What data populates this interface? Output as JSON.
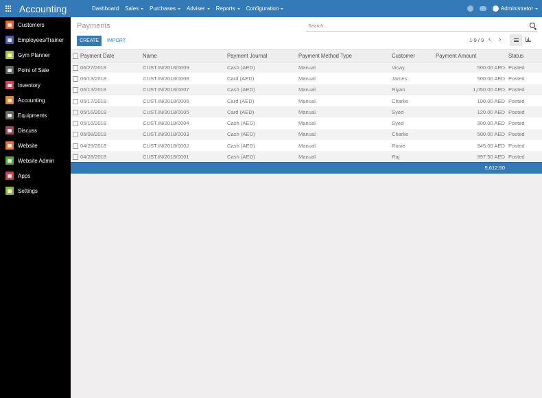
{
  "topbar": {
    "app_title": "Accounting",
    "nav": [
      {
        "label": "Dashboard",
        "dropdown": false
      },
      {
        "label": "Sales",
        "dropdown": true
      },
      {
        "label": "Purchases",
        "dropdown": true
      },
      {
        "label": "Adviser",
        "dropdown": true
      },
      {
        "label": "Reports",
        "dropdown": true
      },
      {
        "label": "Configuration",
        "dropdown": true
      }
    ],
    "user": "Administrator",
    "icons": [
      "apps-grid-icon",
      "activity-clock-icon",
      "chat-icon",
      "avatar-icon"
    ]
  },
  "sidebar": {
    "items": [
      {
        "label": "Customers",
        "icon": "customers-icon",
        "color": "#e8682a"
      },
      {
        "label": "Employees/Trainer",
        "icon": "employees-icon",
        "color": "#4b5fae"
      },
      {
        "label": "Gym Planner",
        "icon": "gym-planner-icon",
        "color": "#a9c23f"
      },
      {
        "label": "Point of Sale",
        "icon": "point-of-sale-icon",
        "color": "#596663"
      },
      {
        "label": "Inventory",
        "icon": "inventory-icon",
        "color": "#d9424e"
      },
      {
        "label": "Accounting",
        "icon": "accounting-icon",
        "color": "#e8862a"
      },
      {
        "label": "Equipments",
        "icon": "equipments-icon",
        "color": "#6b6b63"
      },
      {
        "label": "Discuss",
        "icon": "discuss-icon",
        "color": "#9b4b5e"
      },
      {
        "label": "Website",
        "icon": "website-icon",
        "color": "#e8752a"
      },
      {
        "label": "Website Admin",
        "icon": "website-admin-icon",
        "color": "#58a83f"
      },
      {
        "label": "Apps",
        "icon": "apps-icon",
        "color": "#c8424e"
      },
      {
        "label": "Settings",
        "icon": "settings-icon",
        "color": "#8fb63b"
      }
    ]
  },
  "control": {
    "breadcrumb": "Payments",
    "create_label": "CREATE",
    "import_label": "IMPORT",
    "search_placeholder": "Search...",
    "pager": "1-9 / 9",
    "pager_prev": "‹",
    "pager_next": "›"
  },
  "table": {
    "columns": [
      "Payment Date",
      "Name",
      "Payment Journal",
      "Payment Method Type",
      "Customer",
      "Payment Amount",
      "Status"
    ],
    "rows": [
      {
        "date": "06/27/2018",
        "name": "CUST.IN/2018/0009",
        "journal": "Cash (AED)",
        "method": "Manual",
        "customer": "Vinay",
        "amount": "500.00 AED",
        "status": "Posted"
      },
      {
        "date": "06/13/2018",
        "name": "CUST.IN/2018/0008",
        "journal": "Card (AED)",
        "method": "Manual",
        "customer": "James",
        "amount": "500.00 AED",
        "status": "Posted"
      },
      {
        "date": "06/13/2018",
        "name": "CUST.IN/2018/0007",
        "journal": "Cash (AED)",
        "method": "Manual",
        "customer": "Riyan",
        "amount": "1,050.00 AED",
        "status": "Posted"
      },
      {
        "date": "05/17/2018",
        "name": "CUST.IN/2018/0006",
        "journal": "Card (AED)",
        "method": "Manual",
        "customer": "Charlie",
        "amount": "100.00 AED",
        "status": "Posted"
      },
      {
        "date": "05/16/2018",
        "name": "CUST.IN/2018/0005",
        "journal": "Card (AED)",
        "method": "Manual",
        "customer": "Syed",
        "amount": "120.00 AED",
        "status": "Posted"
      },
      {
        "date": "05/16/2018",
        "name": "CUST.IN/2018/0004",
        "journal": "Cash (AED)",
        "method": "Manual",
        "customer": "Syed",
        "amount": "900.00 AED",
        "status": "Posted"
      },
      {
        "date": "05/08/2018",
        "name": "CUST.IN/2018/0003",
        "journal": "Cash (AED)",
        "method": "Manual",
        "customer": "Charlie",
        "amount": "500.00 AED",
        "status": "Posted"
      },
      {
        "date": "04/29/2018",
        "name": "CUST.IN/2018/0002",
        "journal": "Cash (AED)",
        "method": "Manual",
        "customer": "Rosie",
        "amount": "945.00 AED",
        "status": "Posted"
      },
      {
        "date": "04/28/2018",
        "name": "CUST.IN/2018/0001",
        "journal": "Cash (AED)",
        "method": "Manual",
        "customer": "Raj",
        "amount": "997.50 AED",
        "status": "Posted"
      }
    ],
    "total_amount": "5,612.50"
  },
  "colors": {
    "brand": "#337ab7",
    "sidebar_bg": "#000000",
    "page_bg": "#f0eeee"
  }
}
